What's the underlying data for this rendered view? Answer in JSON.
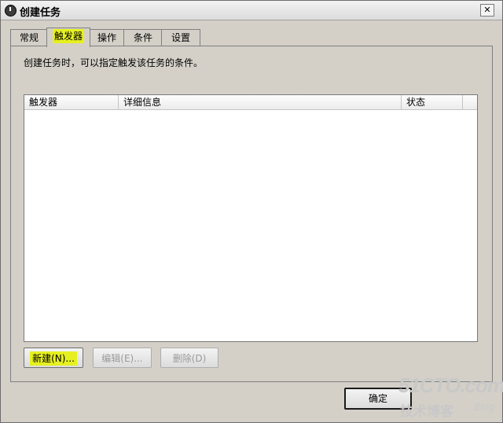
{
  "window": {
    "title": "创建任务",
    "close_label": "✕"
  },
  "tabs": [
    {
      "label": "常规"
    },
    {
      "label": "触发器",
      "active": true
    },
    {
      "label": "操作"
    },
    {
      "label": "条件"
    },
    {
      "label": "设置"
    }
  ],
  "panel": {
    "description": "创建任务时，可以指定触发该任务的条件。"
  },
  "table": {
    "columns": [
      "触发器",
      "详细信息",
      "状态"
    ],
    "rows": []
  },
  "buttons": {
    "new": "新建(N)...",
    "edit": "编辑(E)...",
    "delete": "删除(D)"
  },
  "footer": {
    "ok": "确定"
  },
  "watermark": {
    "site": "51CTO.com",
    "subtitle": "技术博客",
    "blog": "Blog"
  },
  "colors": {
    "highlight": "#e6f020",
    "window_bg": "#d4d0c8"
  }
}
